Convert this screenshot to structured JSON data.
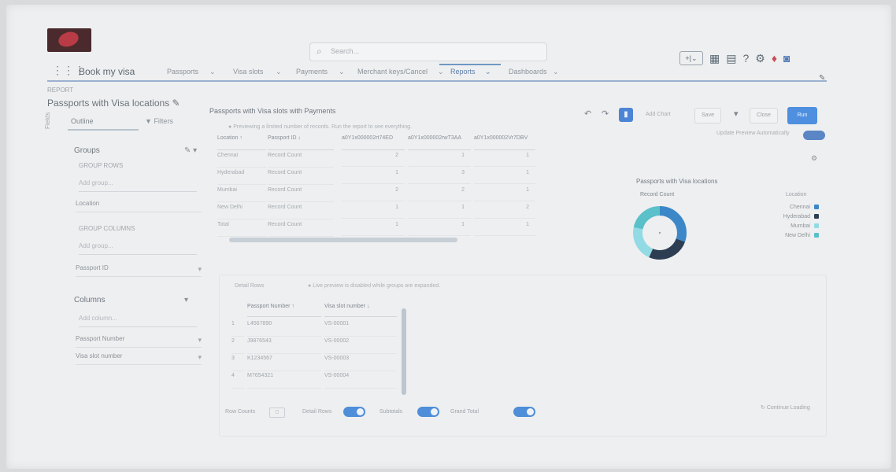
{
  "header": {
    "search_placeholder": "Search...",
    "app_name": "Book my visa",
    "util": {
      "setup_label": "+|⌄"
    }
  },
  "nav": {
    "tabs": [
      {
        "label": "Passports",
        "active": false
      },
      {
        "label": "Visa slots",
        "active": false
      },
      {
        "label": "Payments",
        "active": false
      },
      {
        "label": "Merchant keys/Cancel",
        "active": false
      },
      {
        "label": "Reports",
        "active": true
      },
      {
        "label": "Dashboards",
        "active": false
      }
    ]
  },
  "report": {
    "breadcrumb": "REPORT",
    "title": "Passports with Visa locations"
  },
  "left_panel": {
    "tabs": {
      "outline": "Outline",
      "filters": "Filters"
    },
    "vertical_tab": "Fields",
    "groups_heading": "Groups",
    "group_rows_label": "GROUP ROWS",
    "add_group": "Add group...",
    "row_group": "Location",
    "group_columns_label": "GROUP COLUMNS",
    "col_group": "Passport ID",
    "columns_heading": "Columns",
    "add_column": "Add column...",
    "columns": [
      "Passport Number",
      "Visa slot number"
    ]
  },
  "main": {
    "title": "Passports with Visa slots with Payments",
    "info": "Previewing a limited number of records. Run the report to see everything.",
    "table": {
      "headers": [
        "Location ↑",
        "Passport ID ↓",
        "a0Y1x000002rt74ED",
        "a0Y1x000002rwT3AA",
        "a0Y1x000002Vr7DBV"
      ],
      "rows": [
        [
          "Chennai",
          "Record Count",
          "2",
          "1",
          "1"
        ],
        [
          "Hyderabad",
          "Record Count",
          "1",
          "3",
          "1"
        ],
        [
          "Mumbai",
          "Record Count",
          "2",
          "2",
          "1"
        ],
        [
          "New Delhi",
          "Record Count",
          "1",
          "1",
          "2"
        ],
        [
          "Total",
          "Record Count",
          "1",
          "1",
          "1"
        ]
      ]
    }
  },
  "preview": {
    "label": "Detail Rows",
    "message": "Live preview is disabled while groups are expanded.",
    "headers": [
      "Passport Number ↑",
      "Visa slot number ↓"
    ],
    "rows": [
      [
        "1",
        "L4567890",
        "VS-00001"
      ],
      [
        "2",
        "J9876543",
        "VS-00002"
      ],
      [
        "3",
        "K1234567",
        "VS-00003"
      ],
      [
        "4",
        "M7654321",
        "VS-00004"
      ]
    ],
    "bottom": {
      "row_counts": "Row Counts",
      "detail_rows": "Detail Rows",
      "subtotals": "Subtotals",
      "grand_total": "Grand Total"
    },
    "continue": "Continue Loading"
  },
  "toolbar": {
    "add_chart": "Add Chart",
    "save": "Save",
    "close": "Close",
    "run": "Run",
    "update_preview": "Update Preview Automatically"
  },
  "chart_data": {
    "type": "pie",
    "title": "Passports with Visa locations",
    "subtitle": "Record Count",
    "categories": [
      "Chennai",
      "Hyderabad",
      "Mumbai",
      "New Delhi"
    ],
    "values": [
      7,
      6,
      5,
      5
    ],
    "colors": [
      "#3b87c8",
      "#2d3d52",
      "#93dbe4",
      "#5ac0c9"
    ],
    "legend": "right",
    "legend_title": "Location",
    "donut": true
  }
}
